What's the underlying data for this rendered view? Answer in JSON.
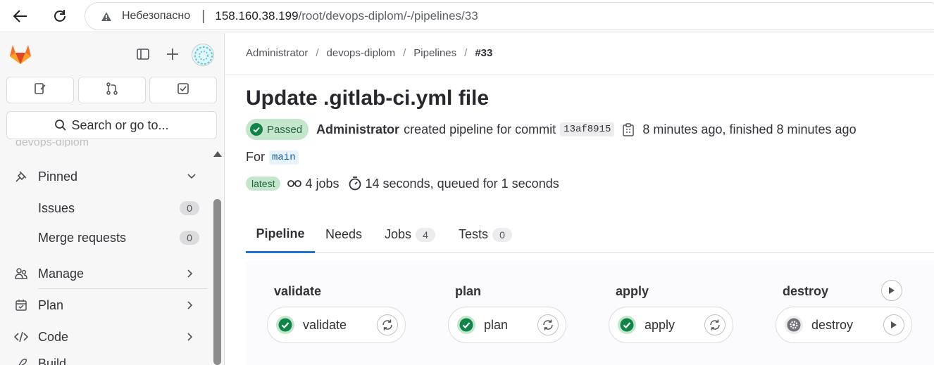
{
  "browser": {
    "insecure_label": "Небезопасно",
    "url_host": "158.160.38.199",
    "url_path": "/root/devops-diplom/-/pipelines/33"
  },
  "sidebar": {
    "search_label": "Search or go to...",
    "ghost_project": "devops-diplom",
    "pinned_label": "Pinned",
    "pinned_items": [
      {
        "label": "Issues",
        "count": "0"
      },
      {
        "label": "Merge requests",
        "count": "0"
      }
    ],
    "sections": [
      {
        "label": "Manage",
        "icon": "users-icon"
      },
      {
        "label": "Plan",
        "icon": "planning-icon"
      },
      {
        "label": "Code",
        "icon": "code-icon"
      },
      {
        "label": "Build",
        "icon": "rocket-icon"
      }
    ]
  },
  "breadcrumb": {
    "items": [
      "Administrator",
      "devops-diplom",
      "Pipelines"
    ],
    "current": "#33"
  },
  "pipeline": {
    "title": "Update .gitlab-ci.yml file",
    "status": "Passed",
    "author": "Administrator",
    "created_text": "created pipeline for commit",
    "commit_sha": "13af8915",
    "time_text": "8 minutes ago, finished 8 minutes ago",
    "for_label": "For",
    "ref": "main",
    "latest_badge": "latest",
    "jobs_text": "4 jobs",
    "duration_text": "14 seconds, queued for 1 seconds"
  },
  "tabs": [
    {
      "label": "Pipeline",
      "count": null
    },
    {
      "label": "Needs",
      "count": null
    },
    {
      "label": "Jobs",
      "count": "4"
    },
    {
      "label": "Tests",
      "count": "0"
    }
  ],
  "stages": [
    {
      "title": "validate",
      "job": "validate",
      "status": "success",
      "action": "retry-icon"
    },
    {
      "title": "plan",
      "job": "plan",
      "status": "success",
      "action": "retry-icon"
    },
    {
      "title": "apply",
      "job": "apply",
      "status": "success",
      "action": "retry-icon"
    },
    {
      "title": "destroy",
      "job": "destroy",
      "status": "manual",
      "action": "play-icon"
    }
  ],
  "colors": {
    "success": "#108548",
    "success_bg": "#c3e6cd",
    "link_blue": "#1f75cb"
  }
}
